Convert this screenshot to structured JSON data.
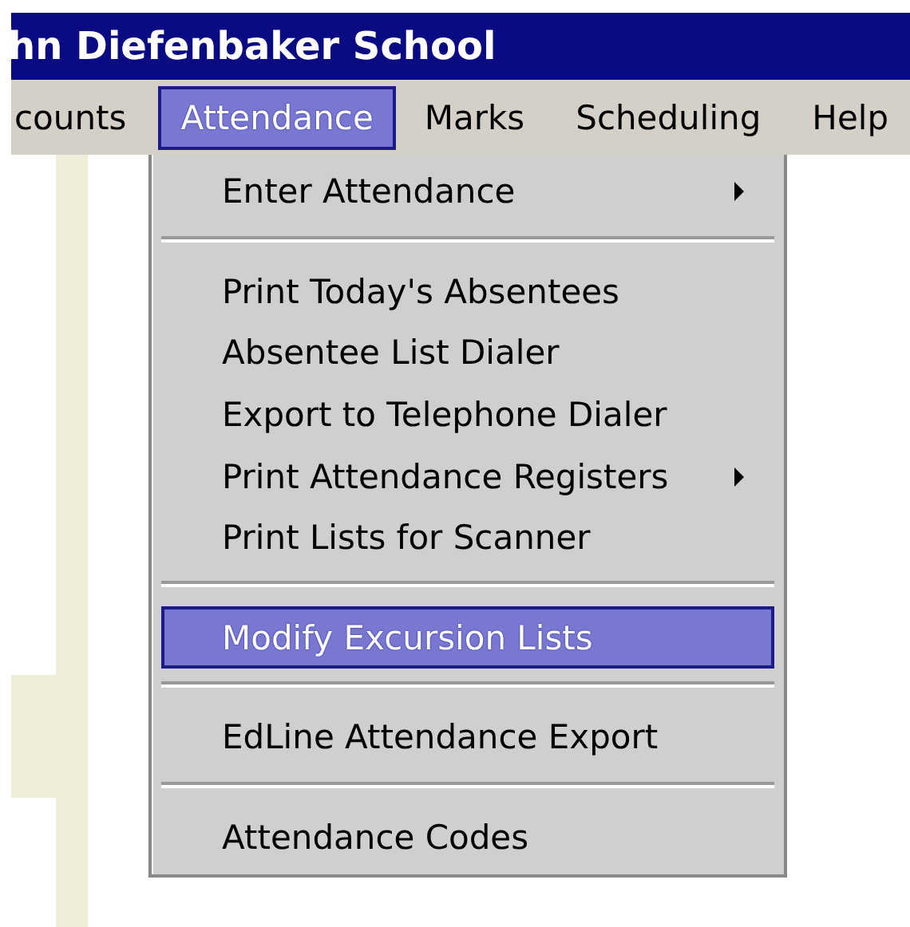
{
  "window": {
    "title": "hn Diefenbaker School"
  },
  "menu_bar": [
    {
      "label": "counts",
      "selected": false
    },
    {
      "label": "Attendance",
      "selected": true
    },
    {
      "label": "Marks",
      "selected": false
    },
    {
      "label": "Scheduling",
      "selected": false
    },
    {
      "label": "Help",
      "selected": false
    }
  ],
  "menu": [
    {
      "kind": "item",
      "label": "Enter Attendance",
      "submenu": true,
      "selected": false
    },
    {
      "kind": "separator"
    },
    {
      "kind": "item",
      "label": "Print Today's Absentees",
      "submenu": false,
      "selected": false
    },
    {
      "kind": "item",
      "label": "Absentee List Dialer",
      "submenu": false,
      "selected": false
    },
    {
      "kind": "item",
      "label": "Export to Telephone Dialer",
      "submenu": false,
      "selected": false
    },
    {
      "kind": "item",
      "label": "Print Attendance Registers",
      "submenu": true,
      "selected": false
    },
    {
      "kind": "item",
      "label": "Print Lists for Scanner",
      "submenu": false,
      "selected": false
    },
    {
      "kind": "separator"
    },
    {
      "kind": "item",
      "label": "Modify Excursion Lists",
      "submenu": false,
      "selected": true
    },
    {
      "kind": "separator"
    },
    {
      "kind": "item",
      "label": "EdLine Attendance Export",
      "submenu": false,
      "selected": false
    },
    {
      "kind": "separator"
    },
    {
      "kind": "item",
      "label": "Attendance Codes",
      "submenu": false,
      "selected": false
    }
  ]
}
